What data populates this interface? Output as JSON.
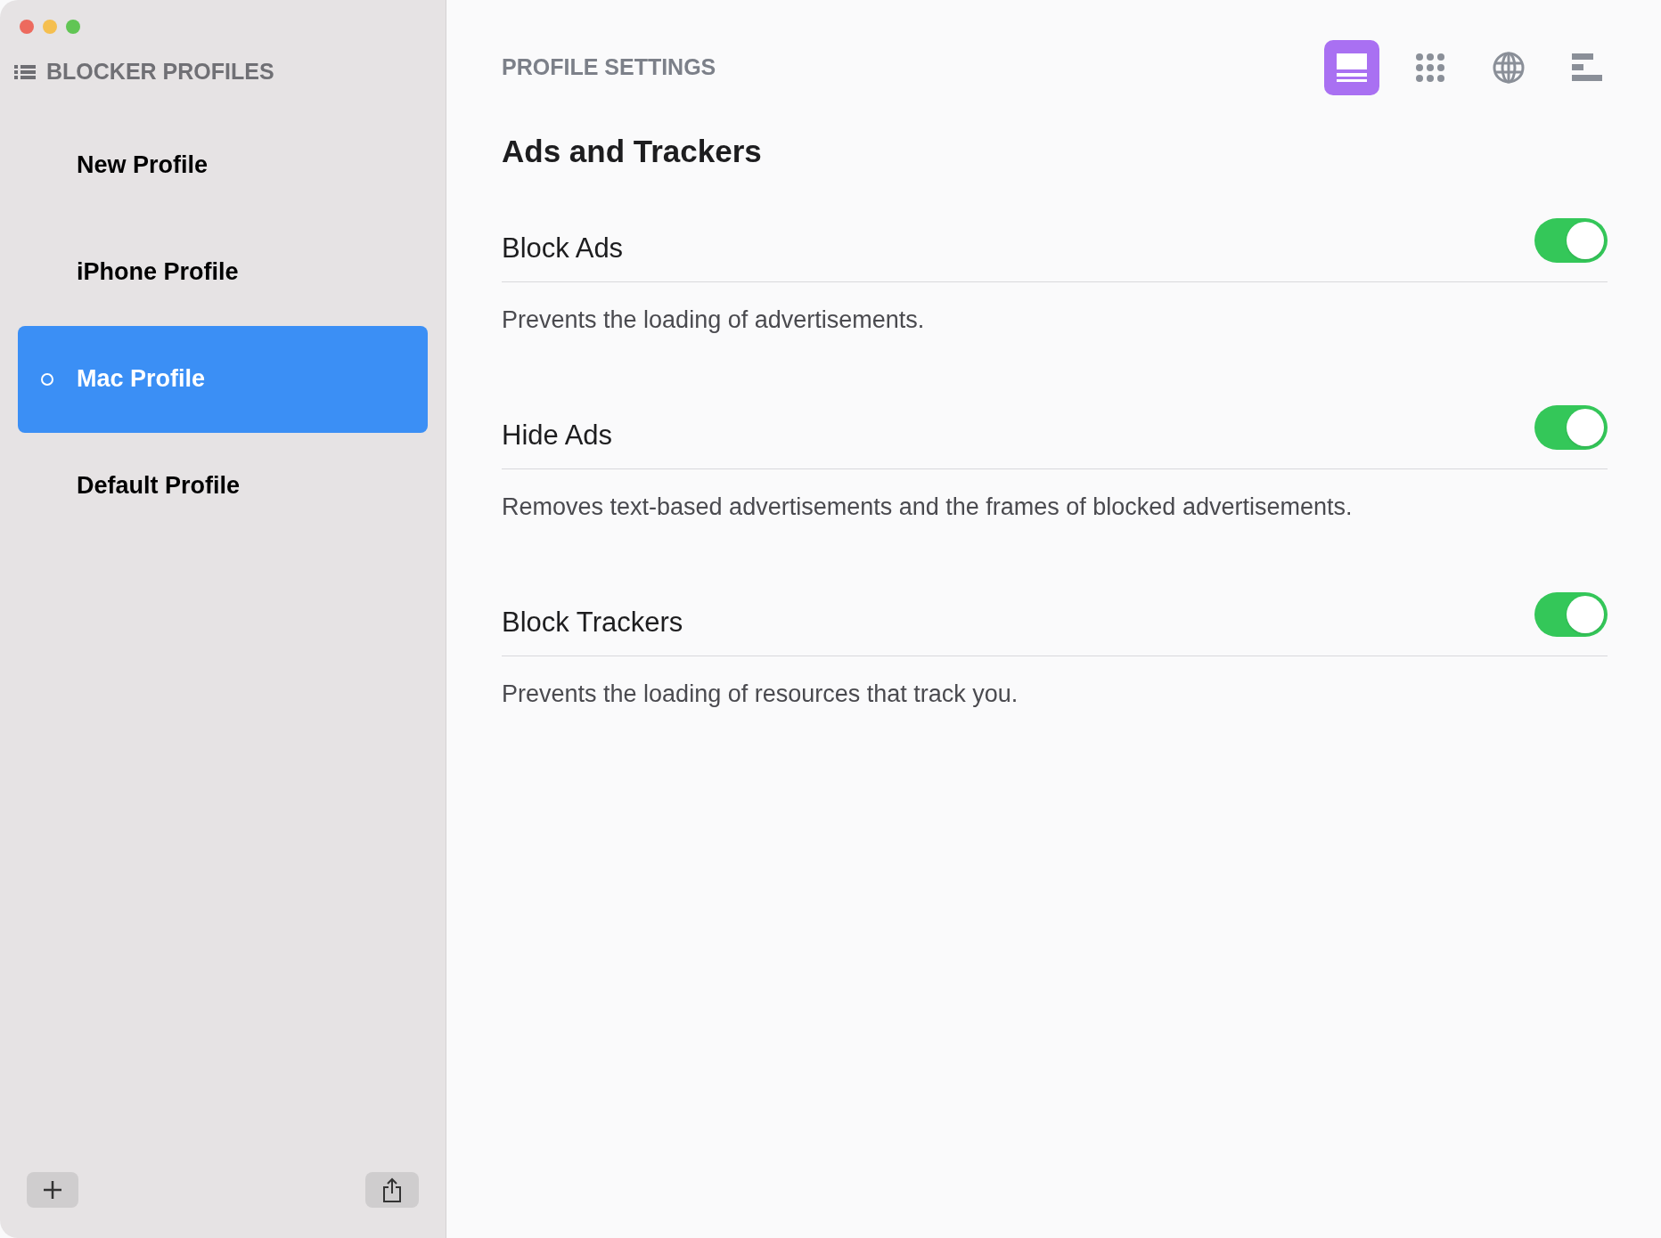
{
  "sidebar": {
    "title": "BLOCKER PROFILES",
    "items": [
      {
        "label": "New Profile",
        "selected": false
      },
      {
        "label": "iPhone Profile",
        "selected": false
      },
      {
        "label": "Mac Profile",
        "selected": true
      },
      {
        "label": "Default Profile",
        "selected": false
      }
    ]
  },
  "main": {
    "title": "PROFILE SETTINGS",
    "toolbar": [
      {
        "kind": "panel",
        "selected": true
      },
      {
        "kind": "grid",
        "selected": false
      },
      {
        "kind": "globe",
        "selected": false
      },
      {
        "kind": "bars",
        "selected": false
      }
    ],
    "section_title": "Ads and Trackers",
    "settings": [
      {
        "label": "Block Ads",
        "on": true,
        "description": "Prevents the loading of advertisements."
      },
      {
        "label": "Hide Ads",
        "on": true,
        "description": "Removes text-based advertisements and the frames of blocked advertisements."
      },
      {
        "label": "Block Trackers",
        "on": true,
        "description": "Prevents the loading of resources that track you."
      }
    ]
  }
}
